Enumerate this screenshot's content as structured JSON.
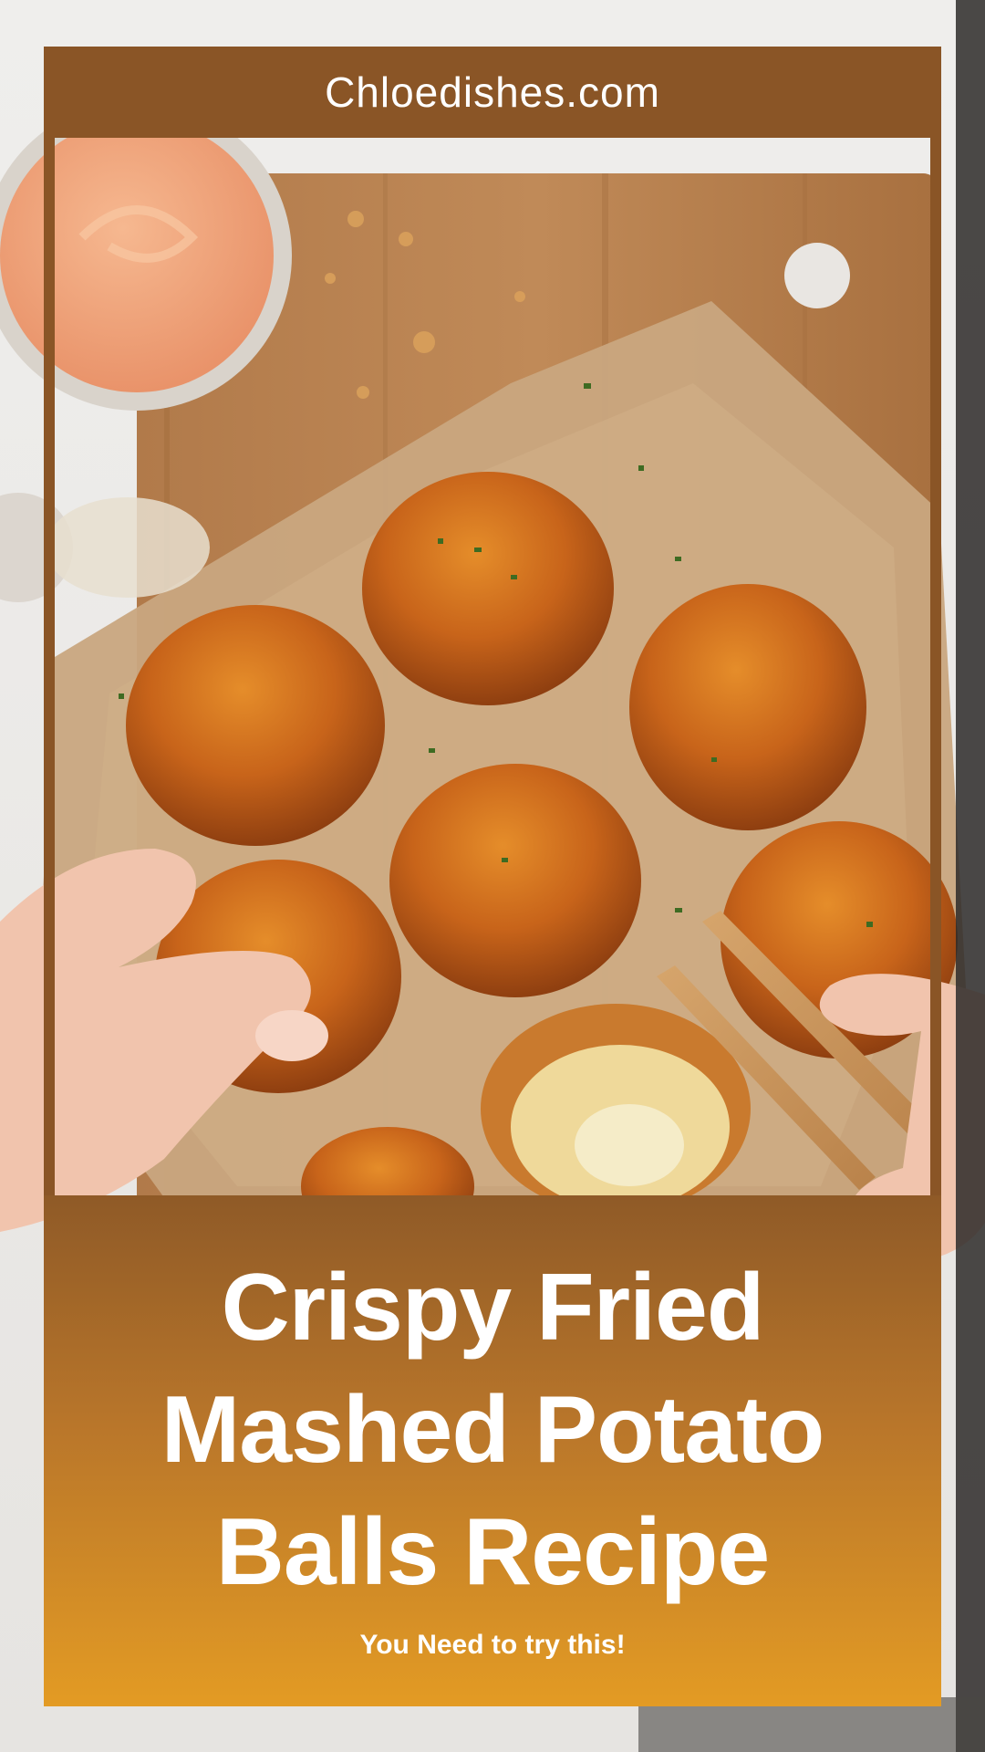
{
  "site": {
    "name": "Chloedishes.com"
  },
  "recipe": {
    "title": "Crispy Fried Mashed Potato Balls Recipe",
    "tagline": "You Need to try this!"
  },
  "colors": {
    "frame_brown": "#8a5526",
    "panel_gradient_top": "#8f5a27",
    "panel_gradient_bottom": "#e39b24",
    "text": "#ffffff"
  },
  "photo": {
    "subject": "fried-mashed-potato-balls-on-parchment",
    "items": [
      "dipping-sauce-bowl",
      "cutting-board",
      "parchment-paper",
      "potato-balls",
      "wooden-tongs",
      "hands"
    ]
  }
}
